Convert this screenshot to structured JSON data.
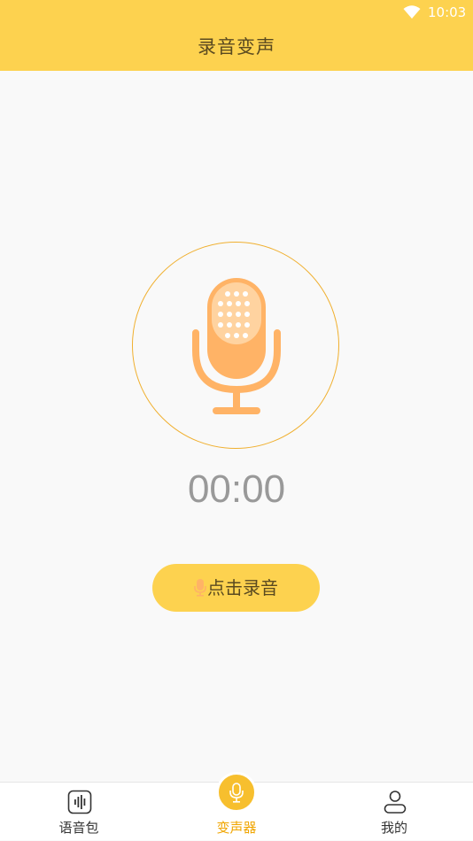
{
  "status_bar": {
    "time": "10:03",
    "wifi_icon": "wifi-icon"
  },
  "header": {
    "title": "录音变声"
  },
  "recorder": {
    "mic_icon": "microphone-icon",
    "timer": "00:00",
    "record_button_label": "点击录音"
  },
  "bottom_nav": {
    "items": [
      {
        "label": "语音包",
        "icon": "voice-wave-icon",
        "active": false
      },
      {
        "label": "变声器",
        "icon": "microphone-icon",
        "active": true
      },
      {
        "label": "我的",
        "icon": "user-icon",
        "active": false
      }
    ]
  },
  "colors": {
    "header_bg": "#fdd24f",
    "accent": "#f0a500",
    "mic_fill": "#ffb366",
    "ring": "#f0b030"
  }
}
